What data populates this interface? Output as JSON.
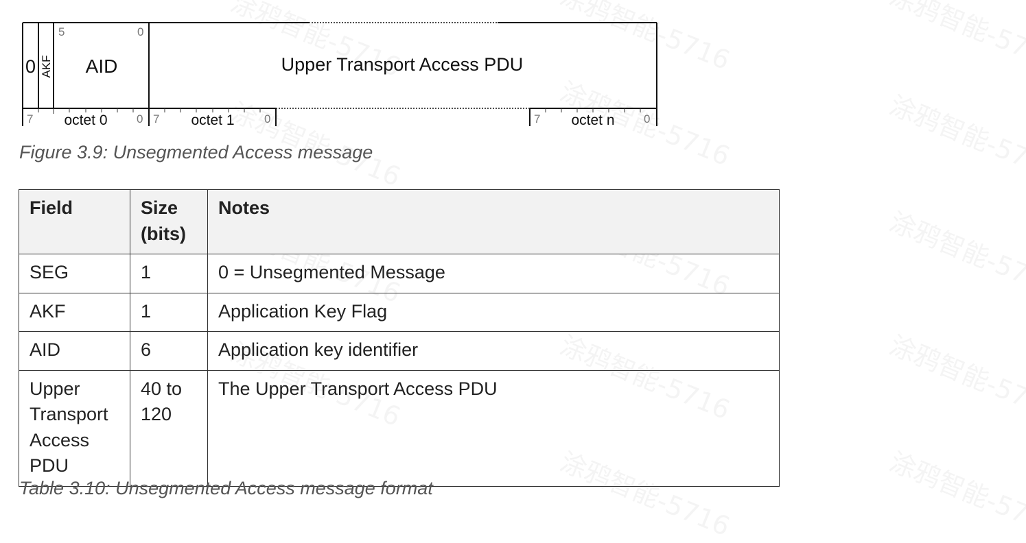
{
  "figure": {
    "bit_labels": {
      "aid_high": "5",
      "aid_low": "0",
      "msb": "7",
      "lsb": "0"
    },
    "seg_value": "0",
    "akf_label": "AKF",
    "aid_label": "AID",
    "pdu_label": "Upper Transport Access PDU",
    "octet_labels": [
      "octet 0",
      "octet 1",
      "octet n"
    ],
    "caption": "Figure 3.9: Unsegmented Access message"
  },
  "table": {
    "headers": {
      "field": "Field",
      "size_line1": "Size",
      "size_line2": "(bits)",
      "notes": "Notes"
    },
    "rows": [
      {
        "field": "SEG",
        "size": "1",
        "notes": "0 = Unsegmented Message"
      },
      {
        "field": "AKF",
        "size": "1",
        "notes": "Application Key Flag"
      },
      {
        "field": "AID",
        "size": "6",
        "notes": "Application key identifier"
      },
      {
        "field_lines": [
          "Upper",
          "Transport",
          "Access",
          "PDU"
        ],
        "size_lines": [
          "40 to",
          "120"
        ],
        "notes": "The Upper Transport Access PDU"
      }
    ],
    "caption": "Table 3.10: Unsegmented Access message format"
  },
  "watermark": "涂鸦智能-5716"
}
